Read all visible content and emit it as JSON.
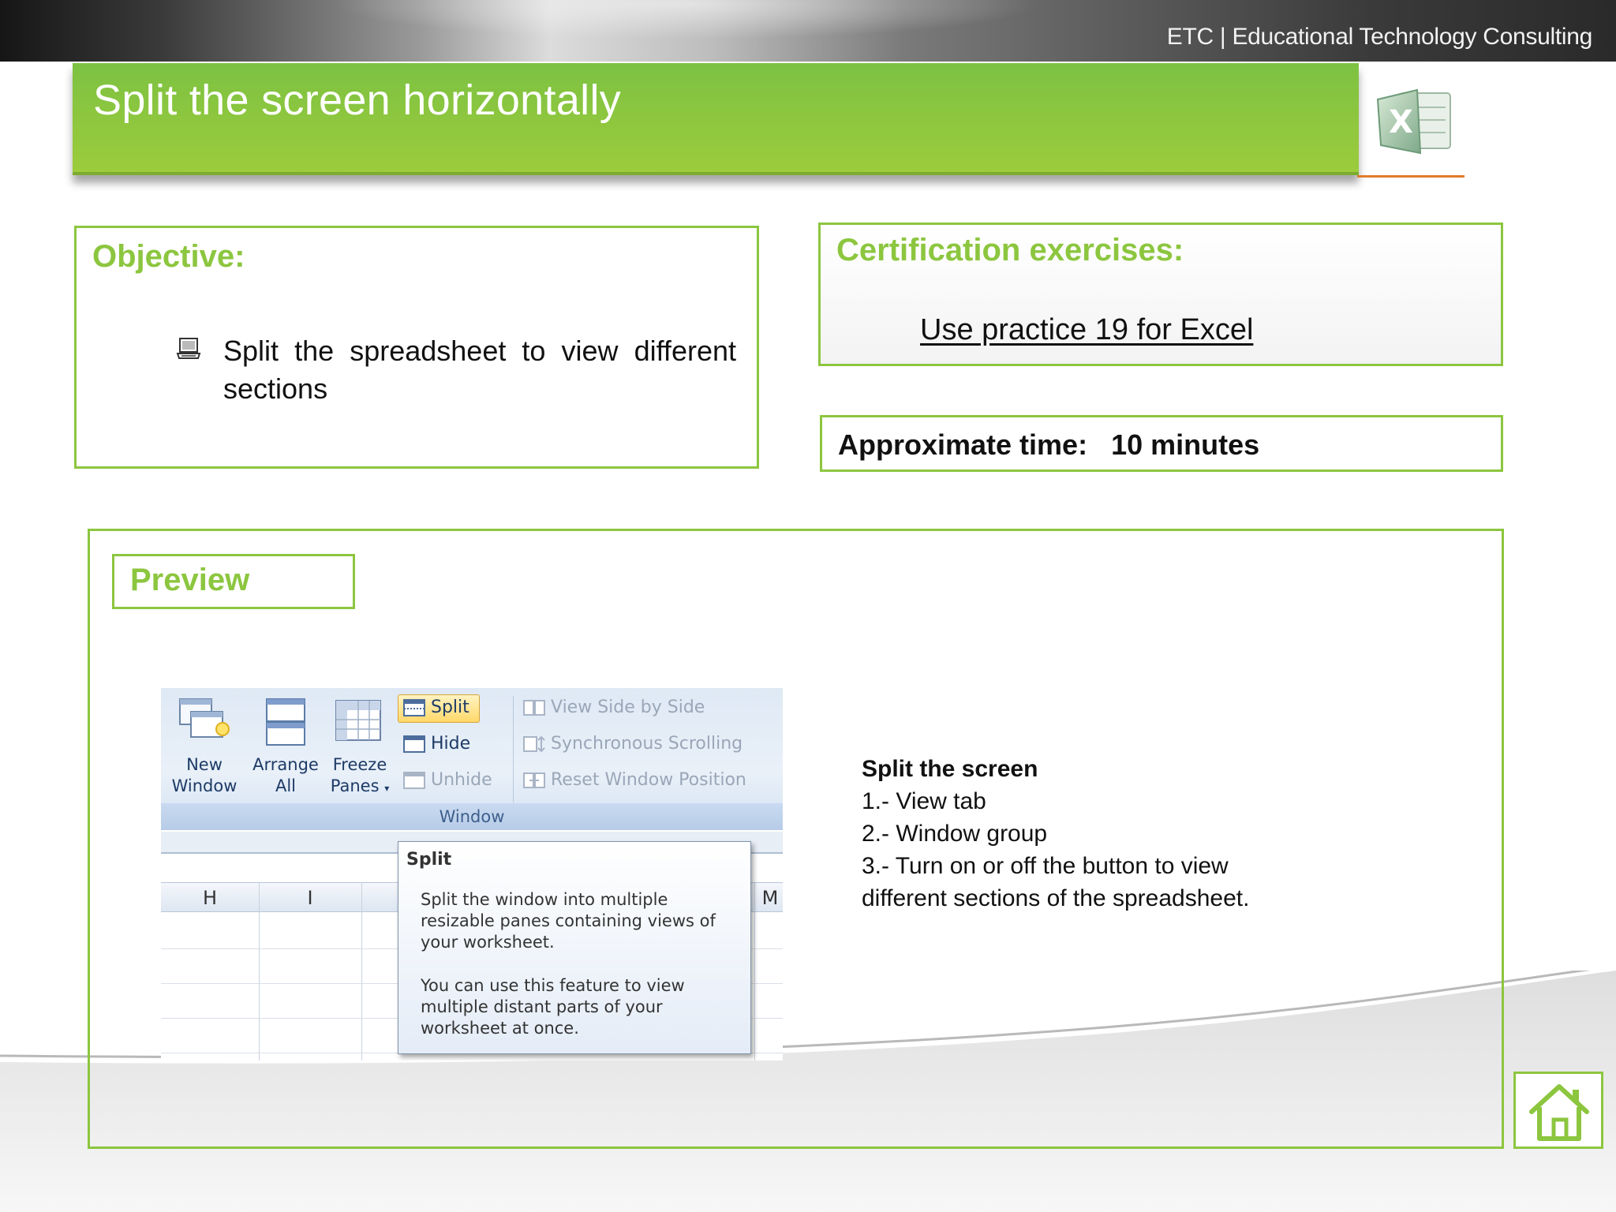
{
  "header": {
    "brand": "ETC | Educational Technology Consulting",
    "title": "Split the screen horizontally",
    "logo_icon": "excel-logo-icon"
  },
  "objective": {
    "heading": "Objective:",
    "items": [
      "Split the spreadsheet to view different sections"
    ],
    "bullet_icon": "computer-icon"
  },
  "certification": {
    "heading": "Certification exercises:",
    "link": "Use practice 19 for Excel"
  },
  "time": {
    "label": "Approximate time:",
    "value": "10 minutes"
  },
  "preview": {
    "heading": "Preview",
    "screenshot": {
      "buttons": {
        "new_window": [
          "New",
          "Window"
        ],
        "arrange_all": [
          "Arrange",
          "All"
        ],
        "freeze_panes": [
          "Freeze",
          "Panes"
        ]
      },
      "split": "Split",
      "hide": "Hide",
      "unhide": "Unhide",
      "view_side_by_side": "View Side by Side",
      "synchronous_scrolling": "Synchronous Scrolling",
      "reset_window_position": "Reset Window Position",
      "group_label": "Window",
      "columns": [
        "H",
        "I",
        "M"
      ],
      "tooltip": {
        "title": "Split",
        "body1": "Split the window into multiple resizable panes containing views of your worksheet.",
        "body2": "You can use this feature to view multiple distant parts of your worksheet at once."
      }
    },
    "steps": {
      "title": "Split the screen",
      "items": [
        "1.- View tab",
        "2.- Window group",
        "3.- Turn on or off the button to view different sections of the spreadsheet."
      ]
    }
  },
  "nav": {
    "home_icon": "home-icon"
  },
  "colors": {
    "accent": "#8cc63f",
    "orange": "#e07b2a"
  }
}
